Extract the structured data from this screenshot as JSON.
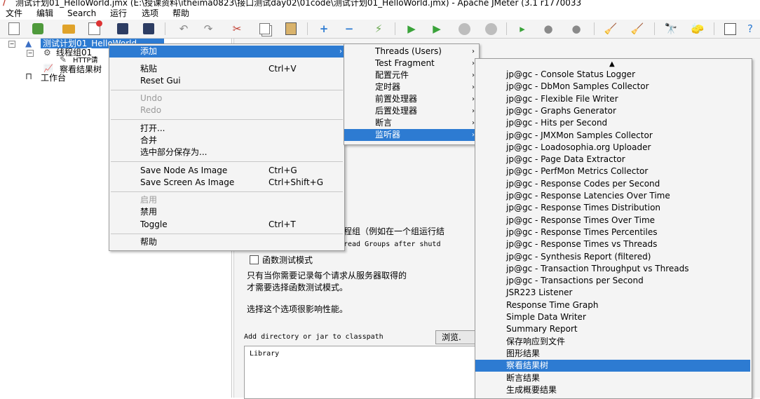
{
  "window": {
    "title": "测试计划01_HelloWorld.jmx (E:\\授课资料\\itheima0823\\接口测试day02\\01code\\测试计划01_HelloWorld.jmx) - Apache JMeter (3.1 r1770033"
  },
  "menubar": {
    "items": [
      "文件",
      "编辑",
      "Search",
      "运行",
      "选项",
      "帮助"
    ]
  },
  "toolbar": {
    "icons": [
      "new-icon",
      "templates-icon",
      "open-icon",
      "close-icon",
      "save-icon",
      "save-as-icon",
      "undo-icon",
      "redo-icon",
      "cut-icon",
      "copy-icon",
      "paste-icon",
      "expand-icon",
      "collapse-icon",
      "toggle-icon",
      "start-icon",
      "start-no-pause-icon",
      "stop-icon",
      "shutdown-icon",
      "remote-start-icon",
      "remote-stop-icon",
      "remote-shutdown-icon",
      "clear-icon",
      "clear-all-icon",
      "search-icon",
      "reset-search-icon",
      "function-helper-icon",
      "help-icon"
    ]
  },
  "tree": {
    "plan": "测试计划01_HelloWorld",
    "thread_group": "线程组01_",
    "http": "HTTP请",
    "listener": "察看结果树",
    "workbench": "工作台"
  },
  "context_menu": {
    "add": "添加",
    "paste": "粘贴",
    "paste_shortcut": "Ctrl+V",
    "reset_gui": "Reset Gui",
    "undo": "Undo",
    "redo": "Redo",
    "open": "打开...",
    "merge": "合并",
    "save_selection": "选中部分保存为...",
    "save_node_image": "Save Node As Image",
    "save_node_image_shortcut": "Ctrl+G",
    "save_screen_image": "Save Screen As Image",
    "save_screen_image_shortcut": "Ctrl+Shift+G",
    "enable": "启用",
    "disable": "禁用",
    "toggle": "Toggle",
    "toggle_shortcut": "Ctrl+T",
    "help": "帮助"
  },
  "add_submenu": {
    "items": [
      "Threads (Users)",
      "Test Fragment",
      "配置元件",
      "定时器",
      "前置处理器",
      "后置处理器",
      "断言",
      "监听器"
    ]
  },
  "listener_submenu": {
    "items": [
      "jp@gc - Console Status Logger",
      "jp@gc - DbMon Samples Collector",
      "jp@gc - Flexible File Writer",
      "jp@gc - Graphs Generator",
      "jp@gc - Hits per Second",
      "jp@gc - JMXMon Samples Collector",
      "jp@gc - Loadosophia.org Uploader",
      "jp@gc - Page Data Extractor",
      "jp@gc - PerfMon Metrics Collector",
      "jp@gc - Response Codes per Second",
      "jp@gc - Response Latencies Over Time",
      "jp@gc - Response Times Distribution",
      "jp@gc - Response Times Over Time",
      "jp@gc - Response Times Percentiles",
      "jp@gc - Response Times vs Threads",
      "jp@gc - Synthesis Report (filtered)",
      "jp@gc - Transaction Throughput vs Threads",
      "jp@gc - Transactions per Second",
      "JSR223 Listener",
      "Response Time Graph",
      "Simple Data Writer",
      "Summary Report",
      "保存响应到文件",
      "图形结果",
      "察看结果树",
      "断言结果",
      "生成概要结果"
    ]
  },
  "content": {
    "run_thread_groups_text": "程组（例如在一个组运行结",
    "teardown_text": "read Groups after shutd",
    "functional_mode": "函数测试模式",
    "desc_line1": "只有当你需要记录每个请求从服务器取得的",
    "desc_line2": "才需要选择函数测试模式。",
    "perf_note": "选择这个选项很影响性能。",
    "classpath_label": "Add directory or jar to classpath",
    "browse": "浏览.",
    "library_header": "Library"
  },
  "colors": {
    "selection": "#2d7bd2",
    "menu_bg": "#f4f4f4"
  }
}
